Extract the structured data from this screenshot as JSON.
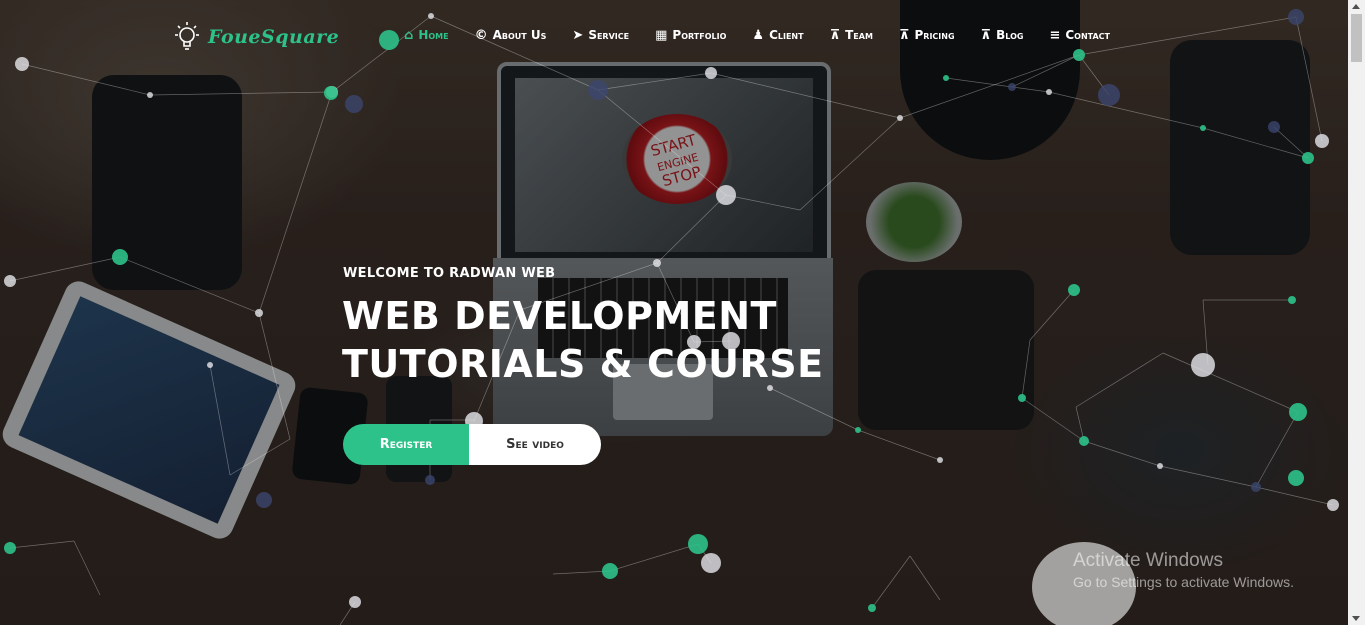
{
  "brand": {
    "name": "FoueSquare",
    "icon": "lightbulb-icon",
    "accent": "#2dc28a"
  },
  "nav": {
    "items": [
      {
        "label": "Home",
        "icon": "home-icon",
        "active": true
      },
      {
        "label": "About Us",
        "icon": "copyright-icon"
      },
      {
        "label": "Service",
        "icon": "paper-plane-icon"
      },
      {
        "label": "Portfolio",
        "icon": "grid-icon"
      },
      {
        "label": "Client",
        "icon": "person-icon"
      },
      {
        "label": "Team",
        "icon": "sitemap-icon"
      },
      {
        "label": "Pricing",
        "icon": "sitemap-icon"
      },
      {
        "label": "Blog",
        "icon": "sitemap-icon"
      },
      {
        "label": "Contact",
        "icon": "align-center-icon"
      }
    ]
  },
  "hero": {
    "welcome": "WELCOME TO RADWAN WEB",
    "headline": "WEB DEVELOPMENT TUTORIALS & COURSE",
    "register_label": "Register",
    "video_label": "See video"
  },
  "laptop_screen": {
    "l1": "START",
    "l2": "ENGINE",
    "l3": "STOP"
  },
  "watermark": {
    "title": "Activate Windows",
    "subtitle": "Go to Settings to activate Windows."
  }
}
